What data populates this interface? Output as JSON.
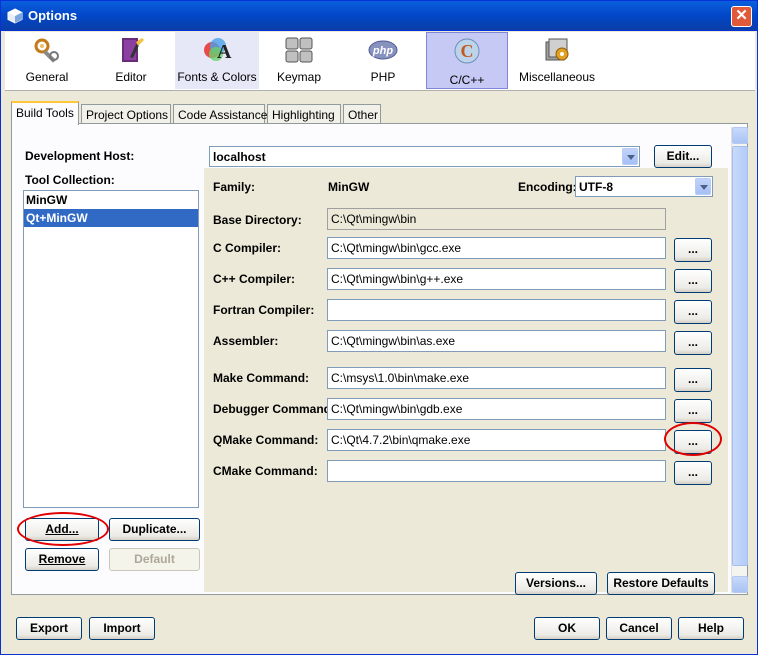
{
  "window": {
    "title": "Options"
  },
  "categories": [
    {
      "label": "General",
      "icon": "tools-icon"
    },
    {
      "label": "Editor",
      "icon": "editor-icon"
    },
    {
      "label": "Fonts & Colors",
      "icon": "fonts-colors-icon"
    },
    {
      "label": "Keymap",
      "icon": "keymap-icon"
    },
    {
      "label": "PHP",
      "icon": "php-icon"
    },
    {
      "label": "C/C++",
      "icon": "cpp-icon",
      "active": true
    },
    {
      "label": "Miscellaneous",
      "icon": "miscellaneous-icon"
    }
  ],
  "tabs": [
    "Build Tools",
    "Project Options",
    "Code Assistance",
    "Highlighting",
    "Other"
  ],
  "build": {
    "dev_host_label": "Development Host:",
    "dev_host_value": "localhost",
    "edit_label": "Edit...",
    "tool_collection_label": "Tool Collection:",
    "tools": [
      "MinGW",
      "Qt+MinGW"
    ],
    "selected_tool": "Qt+MinGW",
    "family_label": "Family:",
    "family_value": "MinGW",
    "encoding_label": "Encoding:",
    "encoding_value": "UTF-8",
    "base_dir_label": "Base Directory:",
    "base_dir_value": "C:\\Qt\\mingw\\bin",
    "rows": [
      {
        "label": "C Compiler:",
        "value": "C:\\Qt\\mingw\\bin\\gcc.exe"
      },
      {
        "label": "C++ Compiler:",
        "value": "C:\\Qt\\mingw\\bin\\g++.exe"
      },
      {
        "label": "Fortran Compiler:",
        "value": ""
      },
      {
        "label": "Assembler:",
        "value": "C:\\Qt\\mingw\\bin\\as.exe"
      },
      {
        "label": "Make Command:",
        "value": "C:\\msys\\1.0\\bin\\make.exe"
      },
      {
        "label": "Debugger Command:",
        "value": "C:\\Qt\\mingw\\bin\\gdb.exe"
      },
      {
        "label": "QMake Command:",
        "value": "C:\\Qt\\4.7.2\\bin\\qmake.exe"
      },
      {
        "label": "CMake Command:",
        "value": ""
      }
    ],
    "browse_label": "...",
    "add_label": "Add...",
    "duplicate_label": "Duplicate...",
    "remove_label": "Remove",
    "default_label": "Default",
    "versions_label": "Versions...",
    "restore_label": "Restore Defaults"
  },
  "footer": {
    "export_label": "Export",
    "import_label": "Import",
    "ok_label": "OK",
    "cancel_label": "Cancel",
    "help_label": "Help"
  },
  "colors": {
    "highlight_circle": "#e00000",
    "selection": "#316ac5",
    "titlebar": "#0a5fdd"
  }
}
